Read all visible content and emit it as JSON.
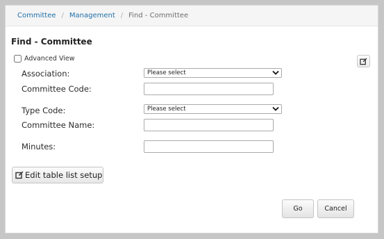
{
  "breadcrumb": {
    "items": [
      "Committee",
      "Management"
    ],
    "current": "Find - Committee",
    "separator": "/"
  },
  "page_title": "Find - Committee",
  "advanced_view": {
    "label": "Advanced View",
    "checked": false
  },
  "form": {
    "association": {
      "label": "Association:",
      "value": "Please select"
    },
    "committee_code": {
      "label": "Committee Code:",
      "value": ""
    },
    "type_code": {
      "label": "Type Code:",
      "value": "Please select"
    },
    "committee_name": {
      "label": "Committee Name:",
      "value": ""
    },
    "minutes": {
      "label": "Minutes:",
      "value": ""
    }
  },
  "edit_list_button": {
    "label": "Edit table list setup",
    "icon": "edit-icon"
  },
  "actions": {
    "go_label": "Go",
    "cancel_label": "Cancel"
  },
  "colors": {
    "link": "#1e6fa8",
    "background": "#c6c6c6",
    "panel": "#ffffff"
  }
}
